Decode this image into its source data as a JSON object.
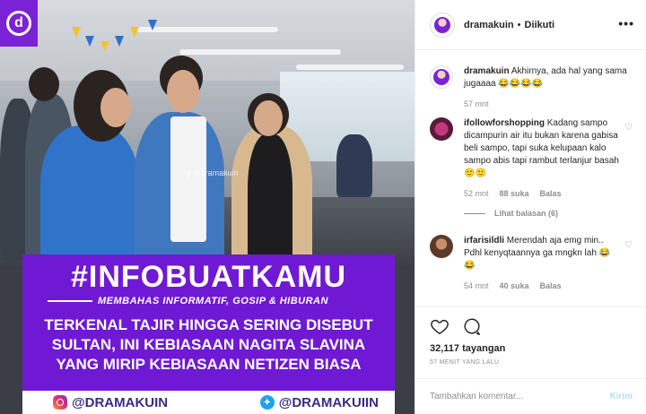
{
  "media": {
    "watermark": "ig @dramakuin",
    "hashtag": "#INFOBUATKAMU",
    "subtitle": "MEMBAHAS INFORMATIF, GOSIP & HIBURAN",
    "headline": "TERKENAL TAJIR HINGGA SERING DISEBUT SULTAN, INI KEBIASAAN NAGITA SLAVINA YANG MIRIP KEBIASAAN NETIZEN BIASA",
    "instagram_handle": "@DRAMAKUIN",
    "twitter_handle": "@DRAMAKUIIN",
    "brand_color": "#7019d4"
  },
  "header": {
    "username": "dramakuin",
    "separator": "•",
    "follow_status": "Diikuti",
    "more_icon": "more-horizontal-icon"
  },
  "comments": [
    {
      "username": "dramakuin",
      "text": "Akhirnya, ada hal yang sama jugaaaa 😂😂😂😂",
      "time": "57 mnt"
    },
    {
      "username": "ifollowforshopping",
      "text": "Kadang sampo dicampurin air itu bukan karena gabisa beli sampo, tapi suka kelupaan kalo sampo abis tapi rambut terlanjur basah 🙂🙂",
      "time": "52 mnt",
      "likes": "88 suka",
      "reply": "Balas",
      "view_replies": "Lihat balasan (6)"
    },
    {
      "username": "irfarisildli",
      "text": "Merendah aja emg min.. Pdhl kenyqtaannya ga mngkn lah 😂😂",
      "time": "54 mnt",
      "likes": "40 suka",
      "reply": "Balas"
    }
  ],
  "actions": {
    "views": "32,117 tayangan",
    "time_ago": "57 MENIT YANG LALU"
  },
  "add_comment": {
    "placeholder": "Tambahkan komentar...",
    "post_label": "Kirim"
  }
}
